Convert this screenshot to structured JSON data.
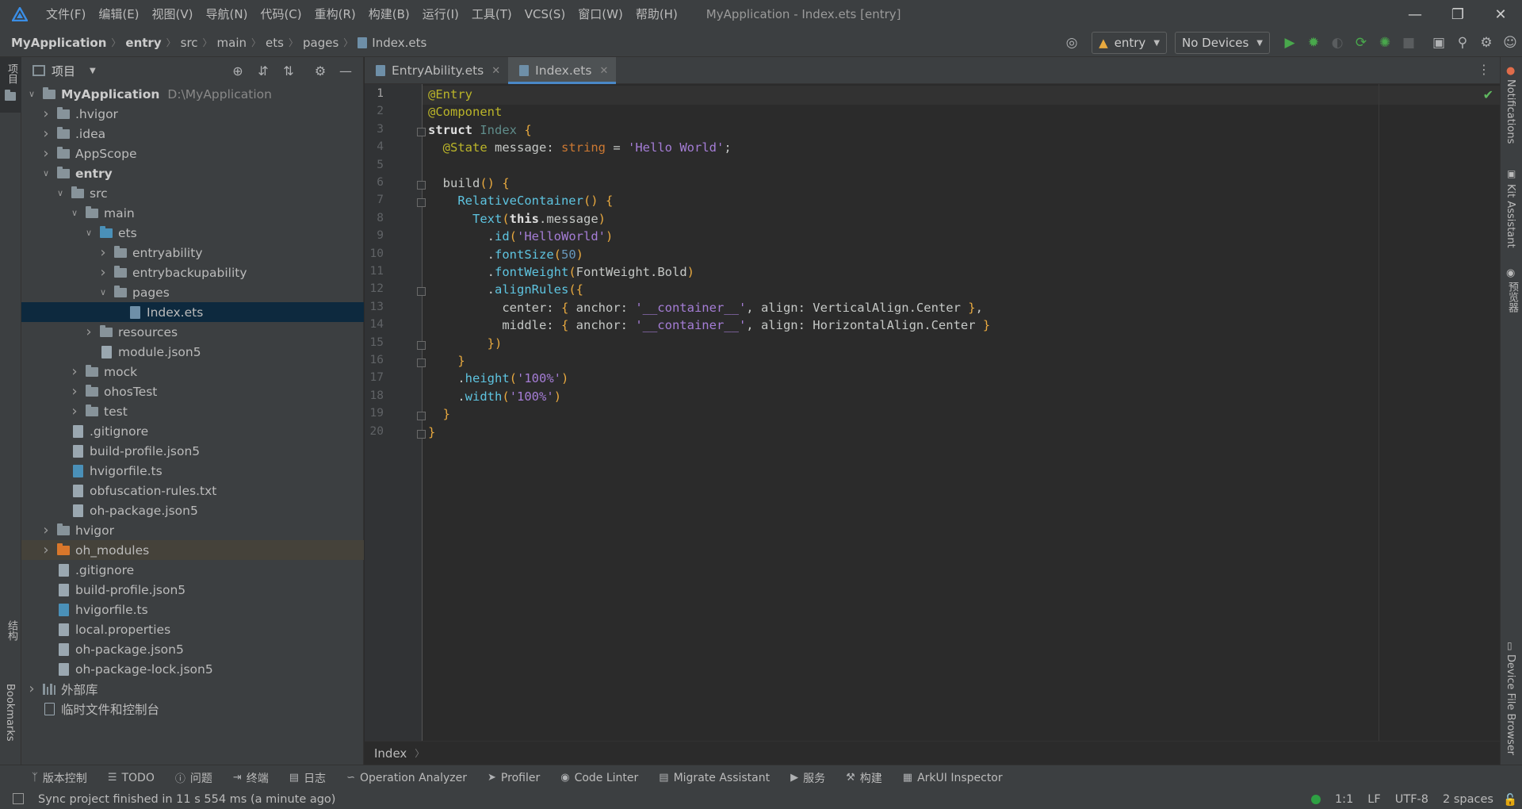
{
  "window": {
    "title": "MyApplication - Index.ets [entry]",
    "menu": [
      "文件(F)",
      "编辑(E)",
      "视图(V)",
      "导航(N)",
      "代码(C)",
      "重构(R)",
      "构建(B)",
      "运行(I)",
      "工具(T)",
      "VCS(S)",
      "窗口(W)",
      "帮助(H)"
    ]
  },
  "breadcrumb": [
    "MyApplication",
    "entry",
    "src",
    "main",
    "ets",
    "pages",
    "Index.ets"
  ],
  "run_config": {
    "module": "entry",
    "device": "No Devices"
  },
  "project_panel": {
    "title": "项目",
    "tree": [
      {
        "label": "MyApplication",
        "extra": "D:\\MyApplication",
        "depth": 0,
        "arrow": "down",
        "icon": "folder",
        "bold": true
      },
      {
        "label": ".hvigor",
        "depth": 1,
        "arrow": "right",
        "icon": "folder"
      },
      {
        "label": ".idea",
        "depth": 1,
        "arrow": "right",
        "icon": "folder"
      },
      {
        "label": "AppScope",
        "depth": 1,
        "arrow": "right",
        "icon": "folder"
      },
      {
        "label": "entry",
        "depth": 1,
        "arrow": "down",
        "icon": "folder",
        "bold": true
      },
      {
        "label": "src",
        "depth": 2,
        "arrow": "down",
        "icon": "folder"
      },
      {
        "label": "main",
        "depth": 3,
        "arrow": "down",
        "icon": "folder"
      },
      {
        "label": "ets",
        "depth": 4,
        "arrow": "down",
        "icon": "folder-blue"
      },
      {
        "label": "entryability",
        "depth": 5,
        "arrow": "right",
        "icon": "folder"
      },
      {
        "label": "entrybackupability",
        "depth": 5,
        "arrow": "right",
        "icon": "folder"
      },
      {
        "label": "pages",
        "depth": 5,
        "arrow": "down",
        "icon": "folder"
      },
      {
        "label": "Index.ets",
        "depth": 6,
        "arrow": "",
        "icon": "file-ets",
        "selected": true
      },
      {
        "label": "resources",
        "depth": 4,
        "arrow": "right",
        "icon": "folder"
      },
      {
        "label": "module.json5",
        "depth": 4,
        "arrow": "",
        "icon": "file"
      },
      {
        "label": "mock",
        "depth": 3,
        "arrow": "right",
        "icon": "folder"
      },
      {
        "label": "ohosTest",
        "depth": 3,
        "arrow": "right",
        "icon": "folder"
      },
      {
        "label": "test",
        "depth": 3,
        "arrow": "right",
        "icon": "folder"
      },
      {
        "label": ".gitignore",
        "depth": 2,
        "arrow": "",
        "icon": "file"
      },
      {
        "label": "build-profile.json5",
        "depth": 2,
        "arrow": "",
        "icon": "file"
      },
      {
        "label": "hvigorfile.ts",
        "depth": 2,
        "arrow": "",
        "icon": "file-ts"
      },
      {
        "label": "obfuscation-rules.txt",
        "depth": 2,
        "arrow": "",
        "icon": "file"
      },
      {
        "label": "oh-package.json5",
        "depth": 2,
        "arrow": "",
        "icon": "file"
      },
      {
        "label": "hvigor",
        "depth": 1,
        "arrow": "right",
        "icon": "folder"
      },
      {
        "label": "oh_modules",
        "depth": 1,
        "arrow": "right",
        "icon": "folder-orange",
        "excluded": true
      },
      {
        "label": ".gitignore",
        "depth": 1,
        "arrow": "",
        "icon": "file"
      },
      {
        "label": "build-profile.json5",
        "depth": 1,
        "arrow": "",
        "icon": "file"
      },
      {
        "label": "hvigorfile.ts",
        "depth": 1,
        "arrow": "",
        "icon": "file-ts"
      },
      {
        "label": "local.properties",
        "depth": 1,
        "arrow": "",
        "icon": "file"
      },
      {
        "label": "oh-package.json5",
        "depth": 1,
        "arrow": "",
        "icon": "file"
      },
      {
        "label": "oh-package-lock.json5",
        "depth": 1,
        "arrow": "",
        "icon": "file"
      },
      {
        "label": "外部库",
        "depth": 0,
        "arrow": "right",
        "icon": "library"
      },
      {
        "label": "临时文件和控制台",
        "depth": 0,
        "arrow": "",
        "icon": "scratch"
      }
    ]
  },
  "left_strip": {
    "project": "项目",
    "structure": "结构",
    "bookmarks": "Bookmarks"
  },
  "right_strip": {
    "notifications": "Notifications",
    "kit": "Kit Assistant",
    "previewer": "预览器",
    "device": "Device File Browser"
  },
  "tabs": [
    {
      "label": "EntryAbility.ets",
      "active": false
    },
    {
      "label": "Index.ets",
      "active": true
    }
  ],
  "editor": {
    "line_numbers": [
      "1",
      "2",
      "3",
      "4",
      "5",
      "6",
      "7",
      "8",
      "9",
      "10",
      "11",
      "12",
      "13",
      "14",
      "15",
      "16",
      "17",
      "18",
      "19",
      "20"
    ],
    "breadcrumb": "Index",
    "lines": [
      [
        [
          "ann",
          "@Entry"
        ]
      ],
      [
        [
          "ann",
          "@Component"
        ]
      ],
      [
        [
          "kwb",
          "struct "
        ],
        [
          "ty",
          "Index "
        ],
        [
          "br",
          "{"
        ]
      ],
      [
        [
          "plain",
          "  "
        ],
        [
          "ann",
          "@State "
        ],
        [
          "plain",
          "message: "
        ],
        [
          "kw",
          "string "
        ],
        [
          "plain",
          "= "
        ],
        [
          "str",
          "'Hello World'"
        ],
        [
          "plain",
          ";"
        ]
      ],
      [
        [
          "plain",
          ""
        ]
      ],
      [
        [
          "plain",
          "  "
        ],
        [
          "plain",
          "build"
        ],
        [
          "br",
          "() {"
        ]
      ],
      [
        [
          "plain",
          "    "
        ],
        [
          "fn",
          "RelativeContainer"
        ],
        [
          "br",
          "() {"
        ]
      ],
      [
        [
          "plain",
          "      "
        ],
        [
          "fn",
          "Text"
        ],
        [
          "br",
          "("
        ],
        [
          "kwb",
          "this"
        ],
        [
          "plain",
          ".message"
        ],
        [
          "br",
          ")"
        ]
      ],
      [
        [
          "plain",
          "        ."
        ],
        [
          "fn",
          "id"
        ],
        [
          "br",
          "("
        ],
        [
          "str",
          "'HelloWorld'"
        ],
        [
          "br",
          ")"
        ]
      ],
      [
        [
          "plain",
          "        ."
        ],
        [
          "fn",
          "fontSize"
        ],
        [
          "br",
          "("
        ],
        [
          "num",
          "50"
        ],
        [
          "br",
          ")"
        ]
      ],
      [
        [
          "plain",
          "        ."
        ],
        [
          "fn",
          "fontWeight"
        ],
        [
          "br",
          "("
        ],
        [
          "plain",
          "FontWeight.Bold"
        ],
        [
          "br",
          ")"
        ]
      ],
      [
        [
          "plain",
          "        ."
        ],
        [
          "fn",
          "alignRules"
        ],
        [
          "br",
          "({"
        ]
      ],
      [
        [
          "plain",
          "          center: "
        ],
        [
          "br",
          "{ "
        ],
        [
          "plain",
          "anchor: "
        ],
        [
          "str",
          "'__container__'"
        ],
        [
          "plain",
          ", align: VerticalAlign.Center "
        ],
        [
          "br",
          "}"
        ],
        [
          "plain",
          ","
        ]
      ],
      [
        [
          "plain",
          "          middle: "
        ],
        [
          "br",
          "{ "
        ],
        [
          "plain",
          "anchor: "
        ],
        [
          "str",
          "'__container__'"
        ],
        [
          "plain",
          ", align: HorizontalAlign.Center "
        ],
        [
          "br",
          "}"
        ]
      ],
      [
        [
          "plain",
          "        "
        ],
        [
          "br",
          "})"
        ]
      ],
      [
        [
          "plain",
          "    "
        ],
        [
          "br",
          "}"
        ]
      ],
      [
        [
          "plain",
          "    ."
        ],
        [
          "fn",
          "height"
        ],
        [
          "br",
          "("
        ],
        [
          "str",
          "'100%'"
        ],
        [
          "br",
          ")"
        ]
      ],
      [
        [
          "plain",
          "    ."
        ],
        [
          "fn",
          "width"
        ],
        [
          "br",
          "("
        ],
        [
          "str",
          "'100%'"
        ],
        [
          "br",
          ")"
        ]
      ],
      [
        [
          "plain",
          "  "
        ],
        [
          "br",
          "}"
        ]
      ],
      [
        [
          "br",
          "}"
        ]
      ]
    ]
  },
  "tool_windows": [
    "版本控制",
    "TODO",
    "问题",
    "终端",
    "日志",
    "Operation Analyzer",
    "Profiler",
    "Code Linter",
    "Migrate Assistant",
    "服务",
    "构建",
    "ArkUI Inspector"
  ],
  "status": {
    "message": "Sync project finished in 11 s 554 ms (a minute ago)",
    "position": "1:1",
    "line_sep": "LF",
    "encoding": "UTF-8",
    "indent": "2 spaces"
  },
  "colors": {
    "accent": "#4a88c7",
    "selected_row": "#0d293e",
    "background": "#2b2b2b",
    "panel": "#3c3f41"
  }
}
